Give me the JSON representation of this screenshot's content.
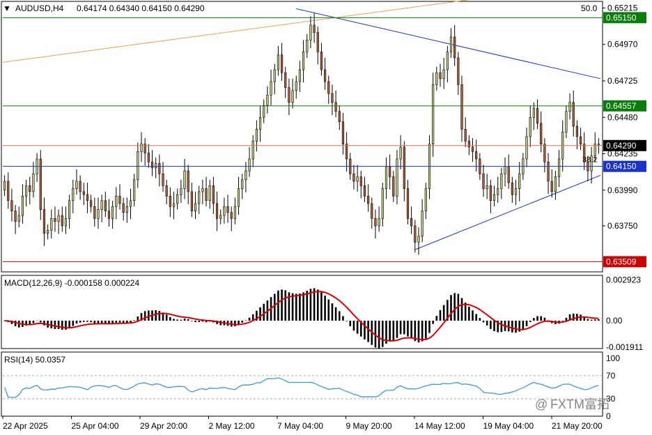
{
  "header": {
    "symbol": "AUDUSD,H4",
    "ohlc": "0.64174 0.64340 0.64150 0.64290",
    "corner_value": "50.0"
  },
  "price_axis": {
    "ticks": [
      "0.65215",
      "0.64970",
      "0.64725",
      "0.64480",
      "0.64235",
      "0.63990",
      "0.63750"
    ],
    "highlight_levels": [
      {
        "value": "0.65150",
        "color": "#0a7d0a",
        "text_color": "#ffffff"
      },
      {
        "value": "0.64557",
        "color": "#0a7d0a",
        "text_color": "#ffffff"
      },
      {
        "value": "0.64290",
        "color": "#000000",
        "text_color": "#ffffff"
      },
      {
        "value": "0.64150",
        "color": "#1a33c8",
        "text_color": "#ffffff"
      },
      {
        "value": "0.63509",
        "color": "#cc0000",
        "text_color": "#ffffff"
      }
    ],
    "fib_label": "38.2"
  },
  "macd": {
    "label": "MACD(12,26,9) -0.000158 0.000224",
    "ticks": [
      "0.002923",
      "0.00",
      "-0.001911"
    ]
  },
  "rsi": {
    "label": "RSI(14) 50.0357",
    "ticks": [
      "100",
      "70",
      "30",
      "0"
    ]
  },
  "time_axis": {
    "labels": [
      "22 Apr 2025",
      "25 Apr 04:00",
      "29 Apr 20:00",
      "2 May 12:00",
      "7 May 04:00",
      "9 May 20:00",
      "14 May 12:00",
      "19 May 04:00",
      "21 May 20:00"
    ]
  },
  "watermark": {
    "text": "FXTM富拓",
    "prefix": "@"
  },
  "colors": {
    "bull": "#b9c97a",
    "bear": "#b45a32",
    "macd_signal": "#dd0000",
    "rsi_line": "#3a9ad9",
    "trendline": "#1a33c8",
    "orange_line": "#f0a050"
  },
  "chart_data": {
    "type": "candlestick",
    "symbol": "AUDUSD",
    "timeframe": "H4",
    "ylim": [
      0.6345,
      0.6525
    ],
    "x": [
      "22 Apr 2025",
      "25 Apr 04:00",
      "29 Apr 20:00",
      "2 May 12:00",
      "7 May 04:00",
      "9 May 20:00",
      "14 May 12:00",
      "19 May 04:00",
      "21 May 20:00"
    ],
    "key_prices": {
      "last": 0.6429,
      "open": 0.64174,
      "high": 0.6434,
      "low": 0.6415,
      "swing_high": 0.6521,
      "swing_low": 0.6359
    },
    "horizontal_levels": [
      0.6515,
      0.64557,
      0.6429,
      0.6415,
      0.63509
    ],
    "closes": [
      0.6405,
      0.6392,
      0.6385,
      0.6378,
      0.6382,
      0.6395,
      0.6402,
      0.6398,
      0.641,
      0.642,
      0.6386,
      0.637,
      0.6372,
      0.638,
      0.6378,
      0.6382,
      0.6375,
      0.638,
      0.6392,
      0.64,
      0.6405,
      0.6398,
      0.6396,
      0.6392,
      0.6388,
      0.638,
      0.6386,
      0.6392,
      0.6385,
      0.638,
      0.6388,
      0.6395,
      0.639,
      0.6384,
      0.6388,
      0.6392,
      0.6406,
      0.6425,
      0.643,
      0.6424,
      0.6418,
      0.6414,
      0.6417,
      0.641,
      0.6402,
      0.6395,
      0.6388,
      0.639,
      0.6396,
      0.64,
      0.6412,
      0.6398,
      0.6385,
      0.639,
      0.6398,
      0.64,
      0.6392,
      0.6402,
      0.639,
      0.638,
      0.6382,
      0.6388,
      0.6384,
      0.638,
      0.6388,
      0.64,
      0.6406,
      0.6412,
      0.642,
      0.6432,
      0.644,
      0.6448,
      0.6456,
      0.6463,
      0.6472,
      0.648,
      0.649,
      0.6478,
      0.6468,
      0.6458,
      0.6466,
      0.6472,
      0.648,
      0.6492,
      0.65,
      0.651,
      0.6505,
      0.6492,
      0.648,
      0.6472,
      0.6464,
      0.6458,
      0.6452,
      0.6445,
      0.643,
      0.642,
      0.641,
      0.6405,
      0.6408,
      0.6402,
      0.6395,
      0.639,
      0.638,
      0.6375,
      0.638,
      0.64,
      0.6415,
      0.6408,
      0.6395,
      0.642,
      0.6428,
      0.64,
      0.638,
      0.6375,
      0.6364,
      0.6368,
      0.6385,
      0.64,
      0.643,
      0.647,
      0.6478,
      0.6474,
      0.648,
      0.6492,
      0.6502,
      0.6488,
      0.647,
      0.644,
      0.6432,
      0.6428,
      0.6425,
      0.642,
      0.641,
      0.64,
      0.6402,
      0.6392,
      0.6396,
      0.64,
      0.641,
      0.6415,
      0.6404,
      0.6396,
      0.64,
      0.641,
      0.642,
      0.6435,
      0.6448,
      0.6454,
      0.6444,
      0.643,
      0.6418,
      0.6405,
      0.6398,
      0.6408,
      0.642,
      0.6438,
      0.6452,
      0.6458,
      0.6442,
      0.6435,
      0.643,
      0.6418,
      0.6412,
      0.6422,
      0.643,
      0.6429
    ]
  }
}
